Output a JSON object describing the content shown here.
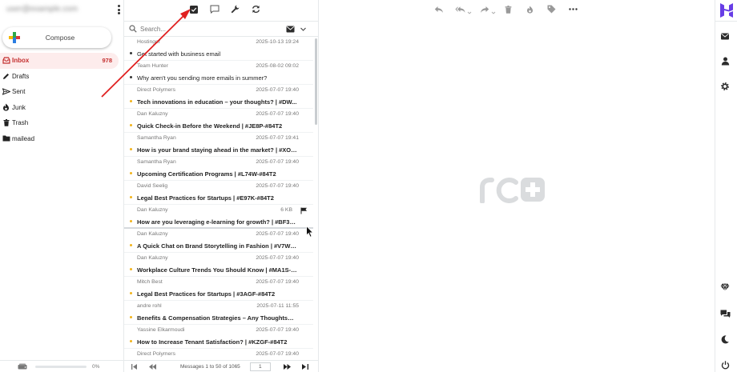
{
  "account": {
    "email": "user@example.com"
  },
  "compose_label": "Compose",
  "folders": [
    {
      "name": "Inbox",
      "count": "978",
      "icon": "inbox-icon",
      "active": true
    },
    {
      "name": "Drafts",
      "count": "",
      "icon": "pencil-icon"
    },
    {
      "name": "Sent",
      "count": "",
      "icon": "paper-plane-icon"
    },
    {
      "name": "Junk",
      "count": "",
      "icon": "fire-icon"
    },
    {
      "name": "Trash",
      "count": "",
      "icon": "trash-icon"
    },
    {
      "name": "mailead",
      "count": "",
      "icon": "folder-icon"
    }
  ],
  "quota": {
    "percent_label": "0%",
    "used_fraction": 0
  },
  "search": {
    "placeholder": "Search..."
  },
  "messages": [
    {
      "from": "Hostinger",
      "date": "2025-10-13 19:24",
      "subject": "Get started with business email",
      "read": true
    },
    {
      "from": "Team Hunter",
      "date": "2025-08-02 09:02",
      "subject": "Why aren't you sending more emails in summer?",
      "read": true
    },
    {
      "from": "Direct Polymers",
      "date": "2025-07-07 19:40",
      "subject": "Tech innovations in education – your thoughts? | #DW...",
      "read": false
    },
    {
      "from": "Dan Kaluzny",
      "date": "2025-07-07 19:40",
      "subject": "Quick Check-in Before the Weekend | #JE8P-#84T2",
      "read": false
    },
    {
      "from": "Samantha Ryan",
      "date": "2025-07-07 19:41",
      "subject": "How is your brand staying ahead in the market? | #XOY...",
      "read": false
    },
    {
      "from": "Samantha Ryan",
      "date": "2025-07-07 19:40",
      "subject": "Upcoming Certification Programs | #L74W-#84T2",
      "read": false
    },
    {
      "from": "David Seelig",
      "date": "2025-07-07 19:40",
      "subject": "Legal Best Practices for Startups | #E97K-#84T2",
      "read": false
    },
    {
      "from": "Dan Kaluzny",
      "date": "",
      "size": "6 KB",
      "flag": true,
      "subject": "How are you leveraging e-learning for growth? | #BF3U...",
      "read": false,
      "hover": true
    },
    {
      "from": "Dan Kaluzny",
      "date": "2025-07-07 19:40",
      "subject": "A Quick Chat on Brand Storytelling in Fashion | #V7WH...",
      "read": false
    },
    {
      "from": "Dan Kaluzny",
      "date": "2025-07-07 19:40",
      "subject": "Workplace Culture Trends You Should Know | #MA1S-#...",
      "read": false
    },
    {
      "from": "Mitch Best",
      "date": "2025-07-07 19:40",
      "subject": "Legal Best Practices for Startups | #3AGF-#84T2",
      "read": false
    },
    {
      "from": "andre rohl",
      "date": "2025-07-11 11:55",
      "subject": "Benefits & Compensation Strategies – Any Thoughts? |...",
      "read": false
    },
    {
      "from": "Yassine Elkarmoudi",
      "date": "2025-07-07 19:40",
      "subject": "How to Increase Tenant Satisfaction? | #KZGF-#84T2",
      "read": false
    },
    {
      "from": "Direct Polymers",
      "date": "2025-07-07 19:40",
      "subject": "",
      "read": false
    }
  ],
  "pager": {
    "count_text": "Messages 1 to 50 of 1065",
    "page": "1"
  },
  "colors": {
    "accent": "#c42f2f",
    "unread_dot": "#f2b31b",
    "annotation_arrow": "#e02020",
    "logo": "#673de6"
  }
}
